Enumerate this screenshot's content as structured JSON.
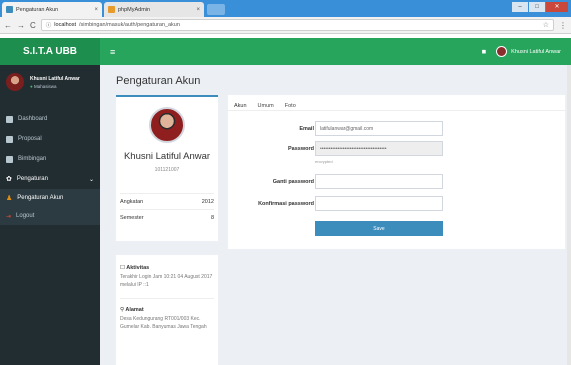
{
  "browser": {
    "tabs": [
      {
        "label": "Pengaturan Akun",
        "active": true,
        "icon_color": "#3c8dbc"
      },
      {
        "label": "phpMyAdmin",
        "active": false,
        "icon_color": "#e69b2b"
      }
    ],
    "url_host": "localhost",
    "url_path": "/simbingan/masuk/auth/pengaturan_akun",
    "tab_close_glyph": "×",
    "back_glyph": "←",
    "forward_glyph": "→",
    "reload_glyph": "C",
    "info_glyph": "ⓘ",
    "star_glyph": "☆",
    "menu_glyph": "⋮",
    "window_controls": [
      "–",
      "□",
      "✕"
    ]
  },
  "header": {
    "brand": "S.I.T.A UBB",
    "burger": "≡",
    "flag_glyph": "◼",
    "user_name": "Khusni Latiful Anwar"
  },
  "sidebar": {
    "user_name": "Khusni Latiful Anwar",
    "status": "Mahasiswa",
    "menu": [
      {
        "label": "Dashboard",
        "icon": "dashboard-icon"
      },
      {
        "label": "Proposal",
        "icon": "file-icon"
      },
      {
        "label": "Bimbingan",
        "icon": "book-icon"
      }
    ],
    "settings": {
      "label": "Pengaturan",
      "chevron": "⌄"
    },
    "submenu": [
      {
        "label": "Pengaturan Akun",
        "icon": "user-icon",
        "glyph": "♟"
      },
      {
        "label": "Logout",
        "icon": "logout-icon",
        "glyph": "⇥"
      }
    ]
  },
  "page": {
    "title": "Pengaturan Akun"
  },
  "profile": {
    "name": "Khusni Latiful Anwar",
    "nim": "101121007",
    "rows": [
      {
        "label": "Angkatan",
        "value": "2012"
      },
      {
        "label": "Semester",
        "value": "8"
      }
    ]
  },
  "about": {
    "activity_title": "Aktivitas",
    "activity_text": "Terakhir Login Jam 10:21 04 August 2017 melalui IP ::1",
    "address_title": "Alamat",
    "address_text": "Desa Kedungurang RT001/003 Kec. Gumelar Kab. Banyumas Jawa Tengah"
  },
  "form": {
    "tabs": [
      "Akun",
      "Umum",
      "Foto"
    ],
    "fields": [
      {
        "label": "Email",
        "value": "latifulanwar@gmail.com"
      },
      {
        "label": "Password",
        "value": "••••••••••••••••••••••••••••••••••••••",
        "help": "encrypted"
      },
      {
        "label": "Ganti password",
        "value": ""
      },
      {
        "label": "Konfirmasi password",
        "value": ""
      }
    ],
    "save_label": "Save"
  },
  "colors": {
    "brand_dark_green": "#1e8e4f",
    "brand_green": "#27a55c",
    "sidebar_bg": "#222d32",
    "primary_blue": "#3c8dbc"
  }
}
